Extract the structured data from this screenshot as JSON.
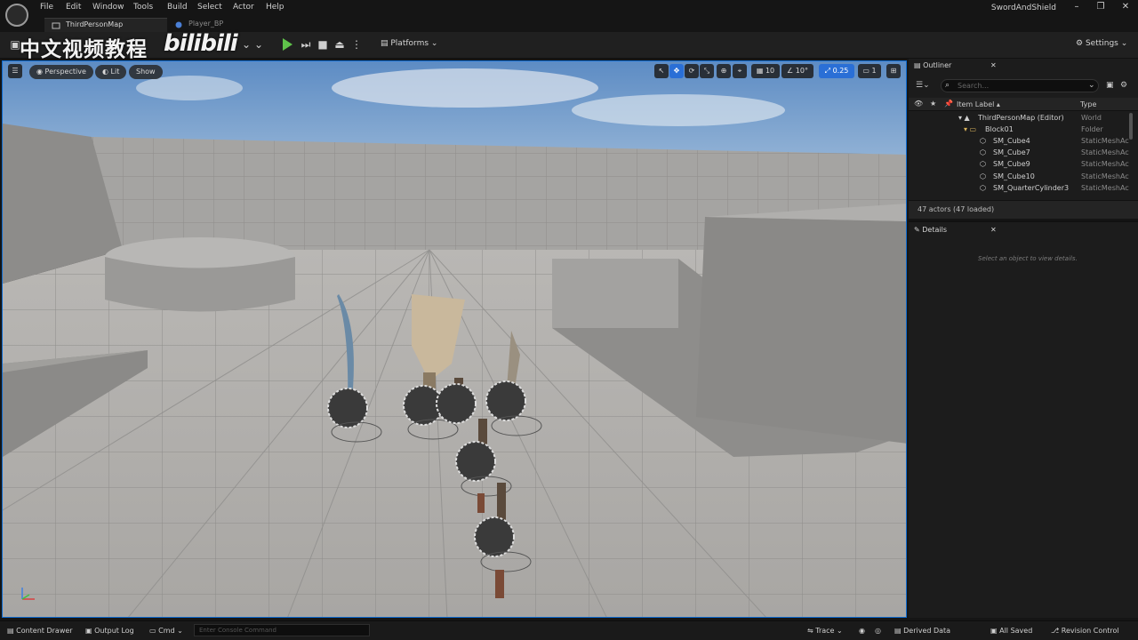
{
  "menu": {
    "items": [
      "File",
      "Edit",
      "Window",
      "Tools",
      "Build",
      "Select",
      "Actor",
      "Help"
    ],
    "project_name": "SwordAndShield",
    "window_controls": [
      "–",
      "❐",
      "✕"
    ]
  },
  "tabs": {
    "map": "ThirdPersonMap",
    "blueprint": "Player_BP"
  },
  "watermark": {
    "cn_text": "中文视频教程",
    "bili_text": "bilibili"
  },
  "toolbar": {
    "platforms_label": "Platforms",
    "settings_label": "Settings",
    "accent_play": "#5fc24a"
  },
  "viewport": {
    "perspective_label": "Perspective",
    "lit_label": "Lit",
    "show_label": "Show",
    "grid_snap": "10",
    "rotation_snap": "10°",
    "scale_snap": "0.25",
    "camera_speed": "1",
    "selection_color": "#0d6ad0"
  },
  "outliner": {
    "title": "Outliner",
    "search_placeholder": "Search...",
    "col_label": "Item Label ▴",
    "col_type": "Type",
    "rows": [
      {
        "label": "ThirdPersonMap (Editor)",
        "type": "World"
      },
      {
        "label": "Block01",
        "type": "Folder"
      },
      {
        "label": "SM_Cube4",
        "type": "StaticMeshActor"
      },
      {
        "label": "SM_Cube7",
        "type": "StaticMeshActor"
      },
      {
        "label": "SM_Cube9",
        "type": "StaticMeshActor"
      },
      {
        "label": "SM_Cube10",
        "type": "StaticMeshActor"
      },
      {
        "label": "SM_QuarterCylinder3",
        "type": "StaticMeshActor"
      }
    ],
    "actor_count": "47 actors (47 loaded)"
  },
  "details": {
    "title": "Details",
    "hint": "Select an object to view details."
  },
  "statusbar": {
    "content_drawer": "Content Drawer",
    "output_log": "Output Log",
    "cmd": "Cmd",
    "console_placeholder": "Enter Console Command",
    "trace": "Trace",
    "derived_data": "Derived Data",
    "all_saved": "All Saved",
    "revision_control": "Revision Control"
  }
}
